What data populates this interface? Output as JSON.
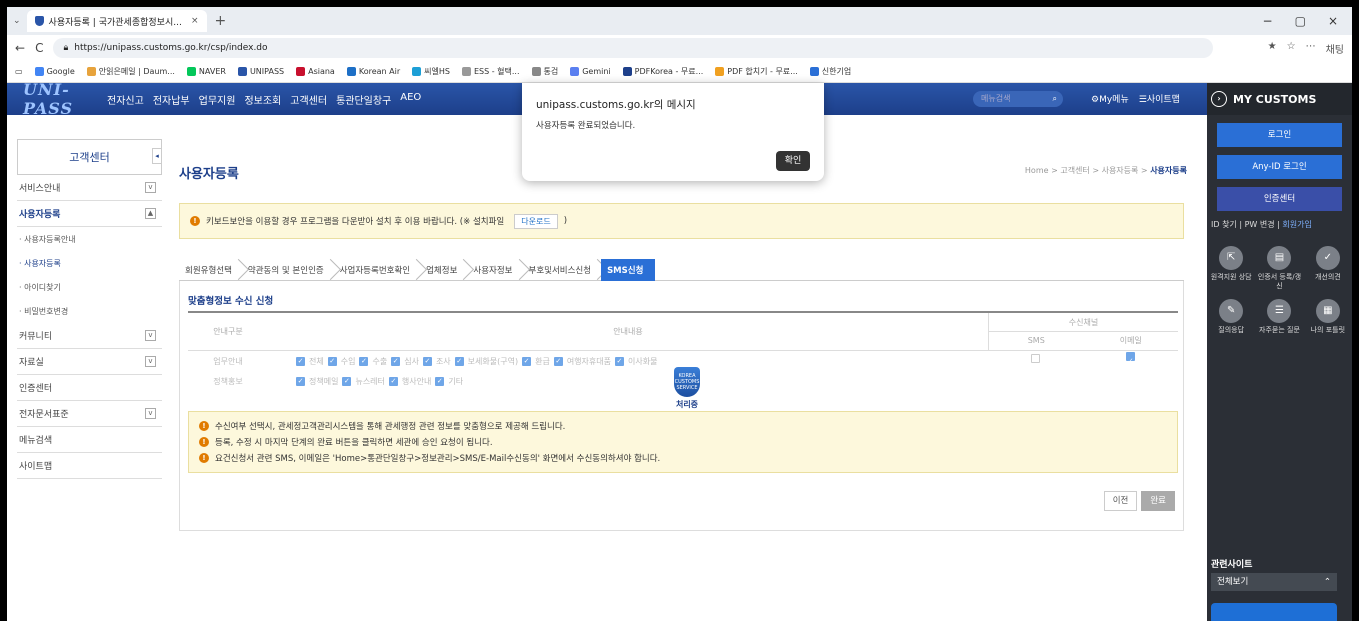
{
  "browser": {
    "tab_title": "사용자등록 | 국가관세종합정보시...",
    "tab_close": "×",
    "new_tab": "+",
    "url": "https://unipass.customs.go.kr/csp/index.do",
    "win_min": "−",
    "win_max": "▢",
    "win_close": "×",
    "copilot": "채팅"
  },
  "bookmarks": [
    {
      "label": "Google",
      "color": "#4285f4"
    },
    {
      "label": "안읽은메일 | Daum...",
      "color": "#e7a33c"
    },
    {
      "label": "NAVER",
      "color": "#03c75a"
    },
    {
      "label": "UNIPASS",
      "color": "#2a55a8"
    },
    {
      "label": "Asiana",
      "color": "#c8102e"
    },
    {
      "label": "Korean Air",
      "color": "#1d6fc6"
    },
    {
      "label": "씨엘HS",
      "color": "#1d9fd6"
    },
    {
      "label": "ESS - 혈택...",
      "color": "#999999"
    },
    {
      "label": "통검",
      "color": "#888888"
    },
    {
      "label": "Gemini",
      "color": "#5a7ff0"
    },
    {
      "label": "PDFKorea - 무료...",
      "color": "#1d3f8a"
    },
    {
      "label": "PDF 합치기 - 무료...",
      "color": "#f0a020"
    },
    {
      "label": "신한기업",
      "color": "#2a6fd6"
    }
  ],
  "site": {
    "logo": "UNI-PASS",
    "menu": [
      "전자신고",
      "전자납부",
      "업무지원",
      "정보조회",
      "고객센터",
      "통관단일창구",
      "AEO"
    ],
    "menu_search": "메뉴검색",
    "my_menu": "My메뉴",
    "sitemap": "사이트맵"
  },
  "leftnav": {
    "header": "고객센터",
    "collapse": "◂",
    "items": [
      {
        "label": "서비스안내",
        "exp": "v"
      },
      {
        "label": "사용자등록",
        "exp": "▲"
      }
    ],
    "subs": [
      "· 사용자등록안내",
      "· 사용자등록",
      "· 아이디찾기",
      "· 비밀번호변경"
    ],
    "items2": [
      {
        "label": "커뮤니티",
        "exp": "v"
      },
      {
        "label": "자료실",
        "exp": "v"
      },
      {
        "label": "인증센터",
        "exp": ""
      },
      {
        "label": "전자문서표준",
        "exp": "v"
      },
      {
        "label": "메뉴검색",
        "exp": ""
      },
      {
        "label": "사이트맵",
        "exp": ""
      }
    ]
  },
  "main": {
    "title": "사용자등록",
    "breadcrumb": [
      "Home",
      "고객센터",
      "사용자등록"
    ],
    "breadcrumb_current": "사용자등록",
    "notice1_text": "키보드보안을 이용할 경우 프로그램을 다운받아 설치 후 이용 바랍니다. (※ 설치파일",
    "notice1_download": "다운로드",
    "notice1_end": ")",
    "steps": [
      "회원유형선택",
      "약관동의 및 본인인증",
      "사업자등록번호확인",
      "업체정보",
      "사용자정보",
      "부호및서비스신청",
      "SMS신청"
    ],
    "section_title": "맞춤형정보 수신 신청",
    "table": {
      "h_type": "안내구분",
      "h_content": "안내내용",
      "h_channel": "수신채널",
      "h_sms": "SMS",
      "h_email": "이메일",
      "rows": [
        {
          "type": "업무안내",
          "opts": [
            "전체",
            "수입",
            "수출",
            "심사",
            "조사",
            "보세화물(구역)",
            "환급",
            "여행자휴대품",
            "이사화물"
          ],
          "sms": false,
          "email": true
        },
        {
          "type": "정책홍보",
          "opts": [
            "정책메일",
            "뉴스레터",
            "행사안내",
            "기타"
          ],
          "sms": null,
          "email": null
        }
      ]
    },
    "loader_text": "처리중",
    "loader_badge": "KOREA CUSTOMS SERVICE",
    "notices": [
      "수신여부 선택시, 관세정고객관리시스템을 통해 관세행정 관련 정보를 맞춤형으로 제공해 드립니다.",
      "등록, 수정 시 마지막 단계의 완료 버튼을 클릭하면 세관에 승인 요청이 됩니다.",
      "요건신청서 관련 SMS, 이메일은 'Home>통관단일창구>정보관리>SMS/E-Mail수신동의' 화면에서 수신동의하셔야 합니다."
    ],
    "btn_prev": "이전",
    "btn_done": "완료"
  },
  "right": {
    "title": "MY CUSTOMS",
    "login": "로그인",
    "anyid": "Any-ID 로그인",
    "cert": "인증센터",
    "id_find": "ID 찾기",
    "pw_change": "PW 변경",
    "join": "회원가입",
    "icons": [
      {
        "label": "원격지원 상담",
        "name": "remote-support-icon",
        "glyph": "⇱"
      },
      {
        "label": "인증서 등록/갱신",
        "name": "certificate-icon",
        "glyph": "▤"
      },
      {
        "label": "개선의견",
        "name": "feedback-icon",
        "glyph": "✓"
      },
      {
        "label": "질의응답",
        "name": "qna-icon",
        "glyph": "✎"
      },
      {
        "label": "자주묻는 질문",
        "name": "faq-icon",
        "glyph": "☰"
      },
      {
        "label": "나의 포틀릿",
        "name": "portlet-icon",
        "glyph": "▦"
      }
    ],
    "related": "관련사이트",
    "related_select": "전체보기"
  },
  "dialog": {
    "title": "unipass.customs.go.kr의 메시지",
    "message": "사용자등록 완료되었습니다.",
    "ok": "확인"
  }
}
